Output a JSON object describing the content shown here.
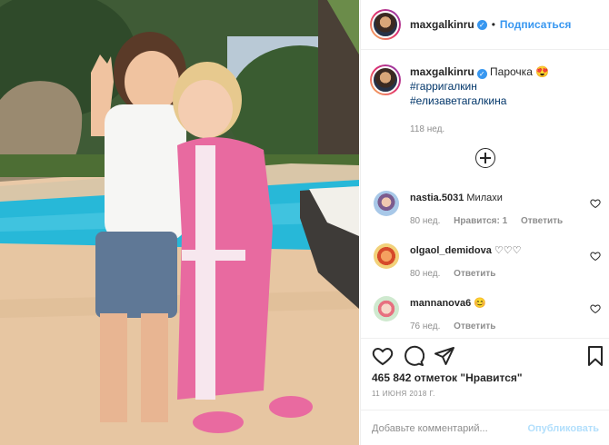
{
  "post": {
    "author": "maxgalkinru",
    "follow_label": "Подписаться",
    "dot": "•",
    "caption_text": "Парочка 😍",
    "hashtags": [
      "#гарригалкин",
      "#елизаветагалкина"
    ],
    "caption_age": "118 нед.",
    "likes": "465 842 отметок \"Нравится\"",
    "date": "11 ИЮНЯ 2018 Г.",
    "comment_placeholder": "Добавьте комментарий...",
    "publish_label": "Опубликовать"
  },
  "comments": [
    {
      "user": "nastia.5031",
      "text": "Милахи",
      "age": "80 нед.",
      "likes": "Нравится: 1",
      "reply": "Ответить"
    },
    {
      "user": "olgaol_demidova",
      "text": "♡♡♡",
      "age": "80 нед.",
      "likes": "",
      "reply": "Ответить"
    },
    {
      "user": "mannanova6",
      "text": "😊",
      "age": "76 нед.",
      "likes": "",
      "reply": "Ответить"
    }
  ],
  "icons": {
    "verified": "verified-badge-icon",
    "heart": "heart-icon",
    "comment": "comment-icon",
    "share": "share-icon",
    "bookmark": "bookmark-icon",
    "load_more": "plus-circle-icon"
  },
  "colors": {
    "link": "#3897f0",
    "hashtag": "#003569",
    "muted": "#8e8e8e",
    "publish_disabled": "#b2dffc"
  }
}
